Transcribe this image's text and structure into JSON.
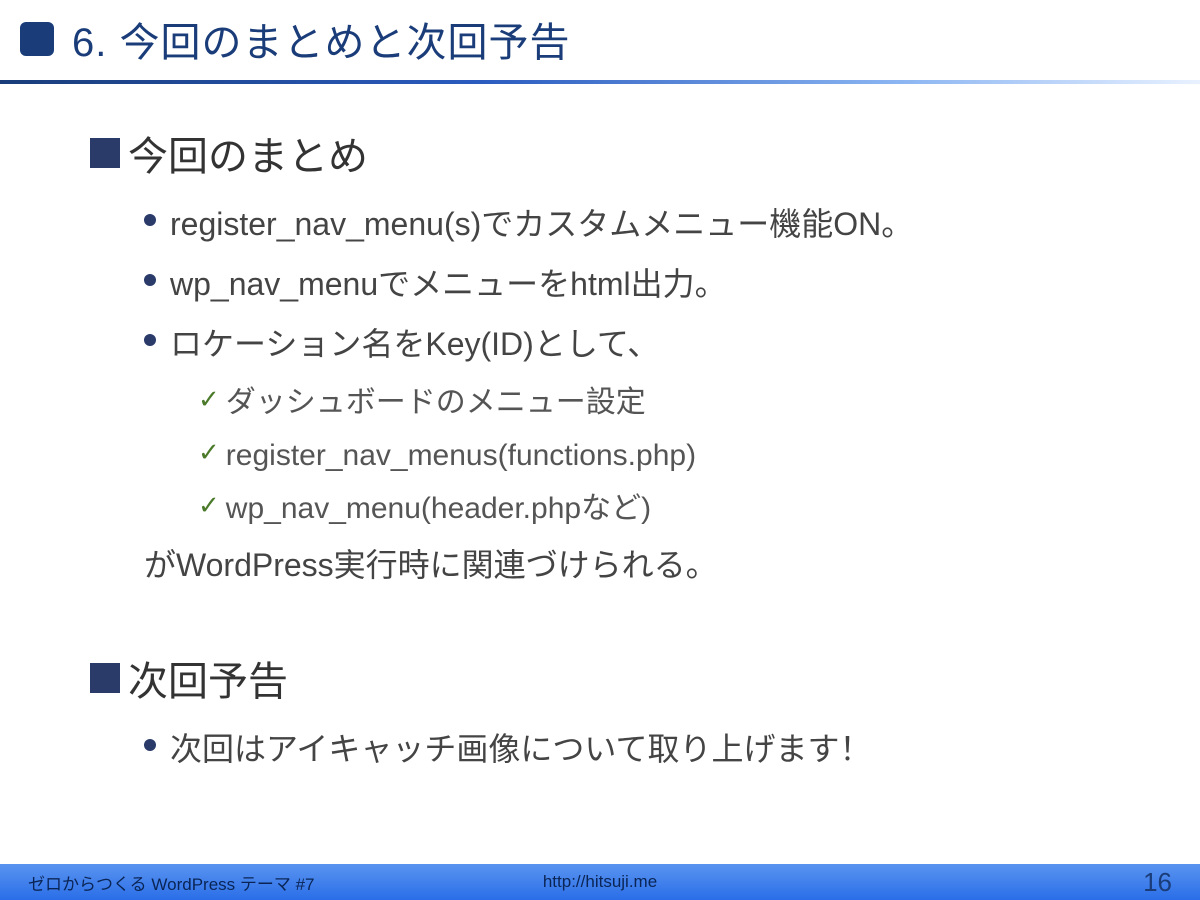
{
  "header": {
    "title": "6. 今回のまとめと次回予告"
  },
  "section1": {
    "title": "今回のまとめ",
    "bullets": [
      "register_nav_menu(s)でカスタムメニュー機能ON。",
      "wp_nav_menuでメニューをhtml出力。",
      "ロケーション名をKey(ID)として、"
    ],
    "checks": [
      "ダッシュボードのメニュー設定",
      "register_nav_menus(functions.php)",
      "wp_nav_menu(header.phpなど)"
    ],
    "tail": "がWordPress実行時に関連づけられる。"
  },
  "section2": {
    "title": "次回予告",
    "bullets": [
      "次回はアイキャッチ画像について取り上げます！"
    ]
  },
  "footer": {
    "left": "ゼロからつくる WordPress テーマ #7",
    "center": "http://hitsuji.me",
    "page": "16"
  }
}
